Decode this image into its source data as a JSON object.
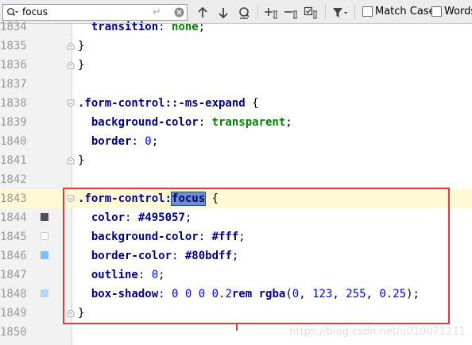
{
  "search": {
    "query": "focus",
    "enter_glyph": "↵",
    "match_case_label": "Match Case",
    "words_label": "Words"
  },
  "editor": {
    "lines": [
      {
        "num": "1834",
        "segs": [
          {
            "t": "  "
          },
          {
            "t": "transition",
            "c": "prop"
          },
          {
            "t": ": "
          },
          {
            "t": "none",
            "c": "val"
          },
          {
            "t": ";"
          }
        ]
      },
      {
        "num": "1835",
        "segs": [
          {
            "t": "}"
          }
        ]
      },
      {
        "num": "1836",
        "segs": [
          {
            "t": "}"
          }
        ]
      },
      {
        "num": "1837",
        "segs": []
      },
      {
        "num": "1838",
        "segs": [
          {
            "t": ".form-control::-ms-expand",
            "c": "sel"
          },
          {
            "t": " {"
          }
        ]
      },
      {
        "num": "1839",
        "segs": [
          {
            "t": "  "
          },
          {
            "t": "background-color",
            "c": "prop"
          },
          {
            "t": ": "
          },
          {
            "t": "transparent",
            "c": "val"
          },
          {
            "t": ";"
          }
        ]
      },
      {
        "num": "1840",
        "segs": [
          {
            "t": "  "
          },
          {
            "t": "border",
            "c": "prop"
          },
          {
            "t": ": "
          },
          {
            "t": "0",
            "c": "num"
          },
          {
            "t": ";"
          }
        ]
      },
      {
        "num": "1841",
        "segs": [
          {
            "t": "}"
          }
        ]
      },
      {
        "num": "1842",
        "segs": []
      },
      {
        "num": "1843",
        "segs": [
          {
            "t": ".form-control",
            "c": "sel"
          },
          {
            "t": ":",
            "c": "sel"
          },
          {
            "t": "focus",
            "c": "match"
          },
          {
            "t": " {"
          }
        ]
      },
      {
        "num": "1844",
        "segs": [
          {
            "t": "  "
          },
          {
            "t": "color",
            "c": "prop"
          },
          {
            "t": ": "
          },
          {
            "t": "#495057",
            "c": "fn"
          },
          {
            "t": ";"
          }
        ]
      },
      {
        "num": "1845",
        "segs": [
          {
            "t": "  "
          },
          {
            "t": "background-color",
            "c": "prop"
          },
          {
            "t": ": "
          },
          {
            "t": "#fff",
            "c": "fn"
          },
          {
            "t": ";"
          }
        ]
      },
      {
        "num": "1846",
        "segs": [
          {
            "t": "  "
          },
          {
            "t": "border-color",
            "c": "prop"
          },
          {
            "t": ": "
          },
          {
            "t": "#80bdff",
            "c": "fn"
          },
          {
            "t": ";"
          }
        ]
      },
      {
        "num": "1847",
        "segs": [
          {
            "t": "  "
          },
          {
            "t": "outline",
            "c": "prop"
          },
          {
            "t": ": "
          },
          {
            "t": "0",
            "c": "num"
          },
          {
            "t": ";"
          }
        ]
      },
      {
        "num": "1848",
        "segs": [
          {
            "t": "  "
          },
          {
            "t": "box-shadow",
            "c": "prop"
          },
          {
            "t": ": "
          },
          {
            "t": "0 0 0 0.2",
            "c": "num"
          },
          {
            "t": "rem",
            "c": "fn"
          },
          {
            "t": " "
          },
          {
            "t": "rgba",
            "c": "fn"
          },
          {
            "t": "("
          },
          {
            "t": "0",
            "c": "num"
          },
          {
            "t": ", "
          },
          {
            "t": "123",
            "c": "num"
          },
          {
            "t": ", "
          },
          {
            "t": "255",
            "c": "num"
          },
          {
            "t": ", "
          },
          {
            "t": "0.25",
            "c": "num"
          },
          {
            "t": ");"
          }
        ]
      },
      {
        "num": "1849",
        "segs": [
          {
            "t": "}"
          }
        ]
      },
      {
        "num": "1850",
        "segs": []
      }
    ],
    "current_line": "1843",
    "swatches": [
      {
        "line": "1844",
        "color": "#495057"
      },
      {
        "line": "1845",
        "color": "#ffffff"
      },
      {
        "line": "1846",
        "color": "#80bdff"
      },
      {
        "line": "1848",
        "color": "#b7d4f5"
      }
    ],
    "fold_markers": {
      "1835": "close",
      "1836": "close",
      "1838": "open",
      "1841": "close",
      "1843": "open",
      "1849": "close"
    }
  },
  "watermark": "https://blog.csdn.net/u010071211",
  "colors": {
    "highlight_border": "#e03b3b",
    "match_background": "#6e8fc7",
    "current_line": "#fff9d6"
  }
}
